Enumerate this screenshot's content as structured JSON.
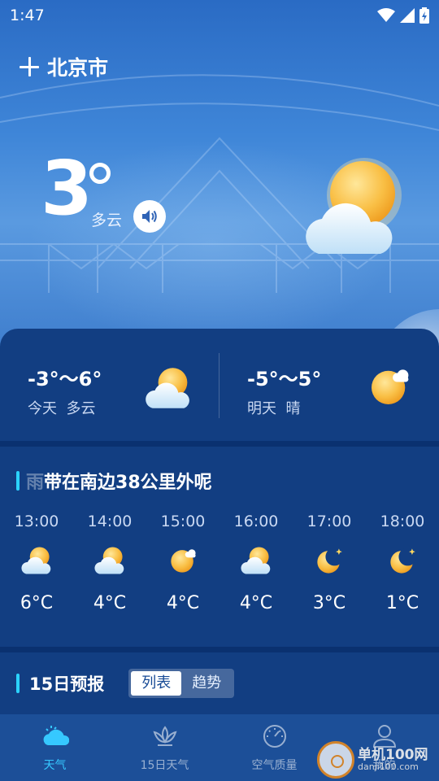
{
  "status_bar": {
    "time": "1:47",
    "icons": [
      "wifi-icon",
      "signal-icon",
      "battery-icon"
    ]
  },
  "header": {
    "add_icon": "plus-icon",
    "city": "北京市"
  },
  "current": {
    "temperature": "3",
    "condition": "多云",
    "icon": "partly-cloudy-icon",
    "speak_icon": "speaker-icon"
  },
  "daily_summary": [
    {
      "range": "-3°～6°",
      "label": "今天  多云",
      "icon": "partly-cloudy-icon"
    },
    {
      "range": "-5°～5°",
      "label": "明天  晴",
      "icon": "sunny-icon"
    }
  ],
  "hourly": {
    "alert_faded": "雨",
    "alert": "带在南边38公里外呢",
    "items": [
      {
        "time": "13:00",
        "temp": "6°C",
        "icon": "partly-cloudy-icon"
      },
      {
        "time": "14:00",
        "temp": "4°C",
        "icon": "partly-cloudy-icon"
      },
      {
        "time": "15:00",
        "temp": "4°C",
        "icon": "sunny-icon"
      },
      {
        "time": "16:00",
        "temp": "4°C",
        "icon": "partly-cloudy-icon"
      },
      {
        "time": "17:00",
        "temp": "3°C",
        "icon": "moon-icon"
      },
      {
        "time": "18:00",
        "temp": "1°C",
        "icon": "moon-icon"
      }
    ]
  },
  "forecast": {
    "title": "15日预报",
    "tabs": [
      "列表",
      "趋势"
    ],
    "active_tab": "列表"
  },
  "nav": [
    {
      "label": "天气",
      "icon": "cloud-icon",
      "active": true
    },
    {
      "label": "15日天气",
      "icon": "lotus-icon",
      "active": false
    },
    {
      "label": "空气质量",
      "icon": "gauge-icon",
      "active": false
    },
    {
      "label": "我的",
      "icon": "user-icon",
      "active": false
    }
  ],
  "watermark": {
    "name": "单机100网",
    "url": "danji100.com"
  },
  "colors": {
    "accent": "#2bd2ff",
    "card": "#123e82",
    "sun": "#f7b93a"
  }
}
